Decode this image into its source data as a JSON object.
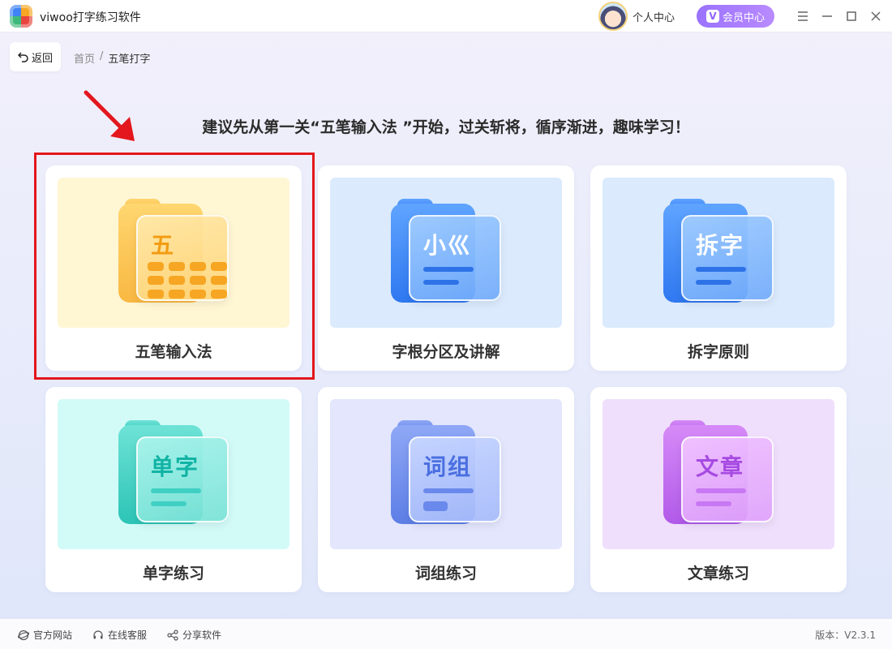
{
  "window": {
    "title": "viwoo打字练习软件",
    "user_center": "个人中心",
    "vip_center": "会员中心",
    "vip_badge": "V"
  },
  "nav": {
    "back_label": "返回",
    "breadcrumb": [
      "首页",
      "/",
      "五笔打字"
    ]
  },
  "hint": "建议先从第一关“五笔输入法 ”开始，过关斩将，循序渐进，趣味学习！",
  "cards": [
    {
      "label": "五笔输入法",
      "art_text": "五",
      "theme": "yellow",
      "highlighted": true
    },
    {
      "label": "字根分区及讲解",
      "art_text": "小巛",
      "theme": "blue"
    },
    {
      "label": "拆字原则",
      "art_text": "拆字",
      "theme": "blue"
    },
    {
      "label": "单字练习",
      "art_text": "单字",
      "theme": "teal"
    },
    {
      "label": "词组练习",
      "art_text": "词组",
      "theme": "indigo"
    },
    {
      "label": "文章练习",
      "art_text": "文章",
      "theme": "purple"
    }
  ],
  "footer": {
    "links": [
      "官方网站",
      "在线客服",
      "分享软件"
    ],
    "version": "版本：V2.3.1"
  },
  "colors": {
    "accent": "#9a72ff",
    "highlight": "#e3171d"
  }
}
